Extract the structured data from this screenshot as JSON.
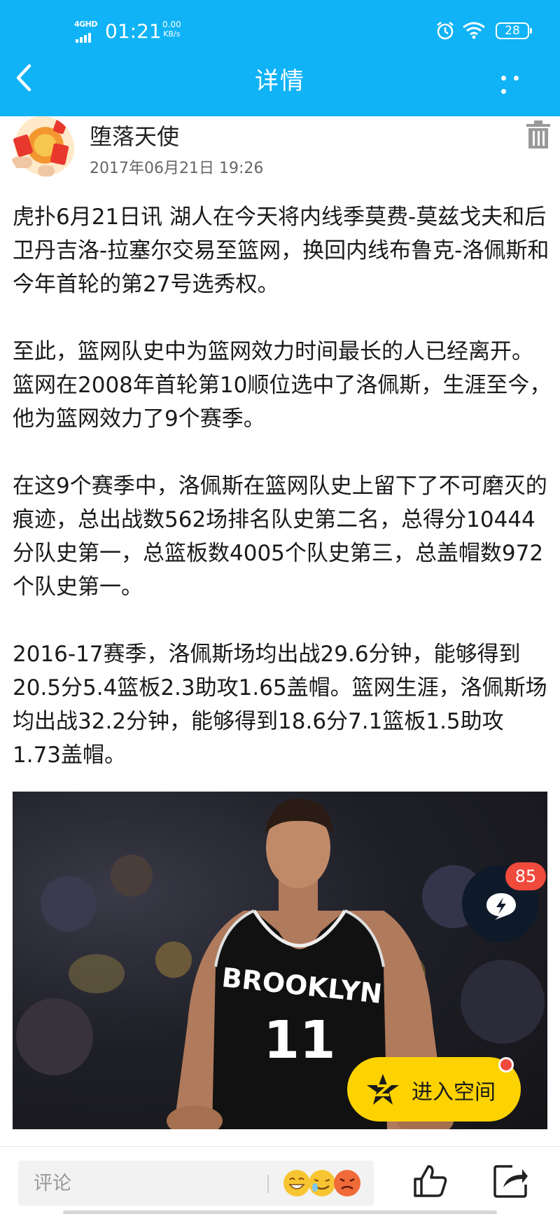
{
  "status_bar": {
    "network": "4GHD",
    "time": "01:21",
    "speed_value": "0.00",
    "speed_unit": "KB/s",
    "battery": "28"
  },
  "header": {
    "title": "详情",
    "back_icon": "back-arrow-icon",
    "more_icon": "more-dots-icon",
    "color": "#0fb3f6"
  },
  "author": {
    "name": "堕落天使",
    "time": "2017年06月21日 19:26",
    "delete_icon": "trash-icon"
  },
  "content": {
    "paragraphs": [
      "虎扑6月21日讯 湖人在今天将内线季莫费-莫兹戈夫和后卫丹吉洛-拉塞尔交易至篮网，换回内线布鲁克-洛佩斯和今年首轮的第27号选秀权。",
      "至此，篮网队史中为篮网效力时间最长的人已经离开。篮网在2008年首轮第10顺位选中了洛佩斯，生涯至今，他为篮网效力了9个赛季。",
      "在这9个赛季中，洛佩斯在篮网队史上留下了不可磨灭的痕迹，总出战数562场排名队史第二名，总得分10444分队史第一，总篮板数4005个队史第三，总盖帽数972个队史第一。",
      "2016-17赛季，洛佩斯场均出战29.6分钟，能够得到20.5分5.4篮板2.3助攻1.65盖帽。篮网生涯，洛佩斯场均出战32.2分钟，能够得到18.6分7.1篮板1.5助攻1.73盖帽。"
    ]
  },
  "photo": {
    "jersey_text": "BROOKLYN",
    "jersey_number": "11"
  },
  "float_badge": {
    "count": "85",
    "icon": "lightning-chat-icon"
  },
  "space_button": {
    "label": "进入空间",
    "icon": "z-logo-icon",
    "color": "#fcd200"
  },
  "bottom_bar": {
    "comment_placeholder": "评论",
    "emoji_icon": "emoji-icon",
    "like_icon": "thumbs-up-icon",
    "share_icon": "share-icon"
  }
}
